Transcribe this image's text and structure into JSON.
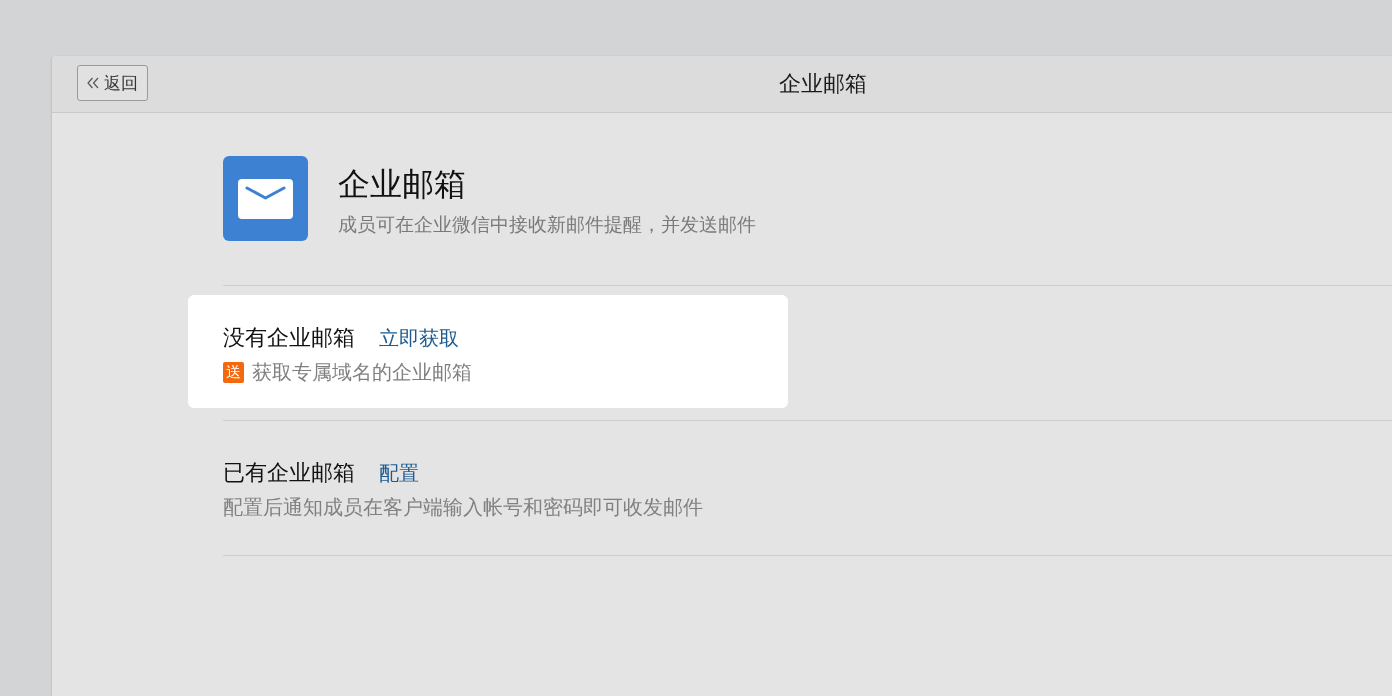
{
  "header": {
    "back_button": {
      "label": "返回"
    },
    "title": "企业邮箱"
  },
  "app": {
    "title": "企业邮箱",
    "description": "成员可在企业微信中接收新邮件提醒，并发送邮件"
  },
  "options": [
    {
      "title": "没有企业邮箱",
      "link": "立即获取",
      "badge": "送",
      "description": "获取专属域名的企业邮箱",
      "highlighted": true
    },
    {
      "title": "已有企业邮箱",
      "link": "配置",
      "description": "配置后通知成员在客户端输入帐号和密码即可收发邮件",
      "highlighted": false
    }
  ]
}
